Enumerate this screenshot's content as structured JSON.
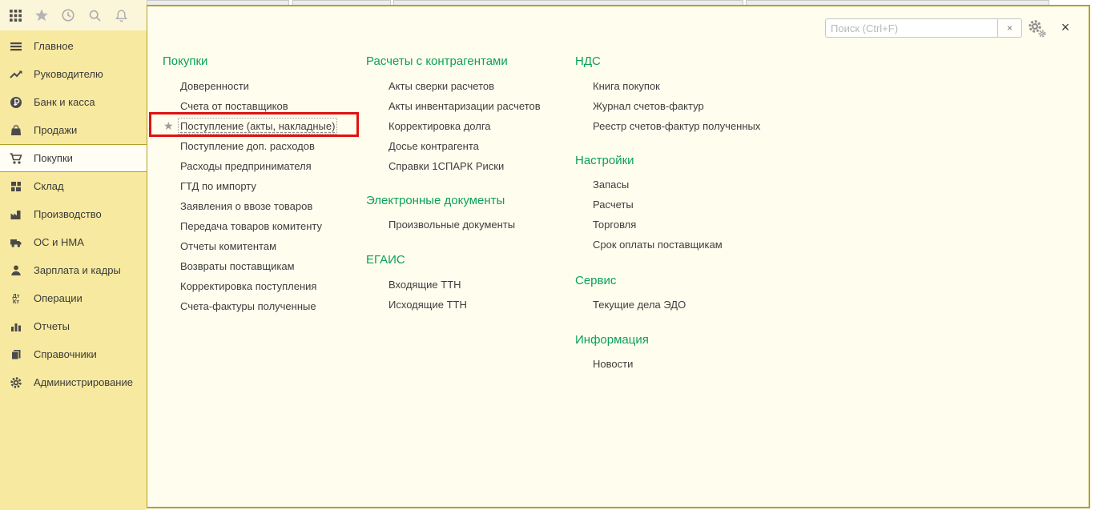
{
  "colors": {
    "sidebar_bg": "#f8e9a0",
    "toolbar_bg": "#fbf5d9",
    "panel_bg": "#fffdee",
    "olive_border": "#b3a128",
    "header_green": "#0aa158",
    "link_text": "#3e3e3e",
    "annotation_red": "#e01212"
  },
  "topbar": {
    "icons": [
      "apps-grid",
      "favorites-star",
      "history-clock",
      "search-magnifier",
      "notifications-bell"
    ]
  },
  "sidebar": {
    "items": [
      {
        "label": "Главное",
        "icon": "menu"
      },
      {
        "label": "Руководителю",
        "icon": "trend-arrow"
      },
      {
        "label": "Банк и касса",
        "icon": "ruble-coin"
      },
      {
        "label": "Продажи",
        "icon": "shopping-bag"
      },
      {
        "label": "Покупки",
        "icon": "shopping-cart",
        "selected": true
      },
      {
        "label": "Склад",
        "icon": "warehouse-grid"
      },
      {
        "label": "Производство",
        "icon": "factory"
      },
      {
        "label": "ОС и НМА",
        "icon": "truck"
      },
      {
        "label": "Зарплата и кадры",
        "icon": "person"
      },
      {
        "label": "Операции",
        "icon": "dt-kt",
        "icon_text_top": "Дт",
        "icon_text_bottom": "Кт"
      },
      {
        "label": "Отчеты",
        "icon": "bar-chart"
      },
      {
        "label": "Справочники",
        "icon": "books"
      },
      {
        "label": "Администрирование",
        "icon": "gear"
      }
    ]
  },
  "panel": {
    "search": {
      "placeholder": "Поиск (Ctrl+F)",
      "clear_label": "×"
    },
    "close_label": "×",
    "star_glyph": "★",
    "annotation": {
      "type": "red-box",
      "target": "Поступление (акты, накладные)"
    },
    "columns": [
      {
        "sections": [
          {
            "title": "Покупки",
            "items": [
              {
                "label": "Доверенности"
              },
              {
                "label": "Счета от поставщиков"
              },
              {
                "label": "Поступление (акты, накладные)",
                "starred": true,
                "highlighted": true
              },
              {
                "label": "Поступление доп. расходов"
              },
              {
                "label": "Расходы предпринимателя"
              },
              {
                "label": "ГТД по импорту"
              },
              {
                "label": "Заявления о ввозе товаров"
              },
              {
                "label": "Передача товаров комитенту"
              },
              {
                "label": "Отчеты комитентам"
              },
              {
                "label": "Возвраты поставщикам"
              },
              {
                "label": "Корректировка поступления"
              },
              {
                "label": "Счета-фактуры полученные"
              }
            ]
          }
        ]
      },
      {
        "sections": [
          {
            "title": "Расчеты с контрагентами",
            "items": [
              {
                "label": "Акты сверки расчетов"
              },
              {
                "label": "Акты инвентаризации расчетов"
              },
              {
                "label": "Корректировка долга"
              },
              {
                "label": "Досье контрагента"
              },
              {
                "label": "Справки 1СПАРК Риски"
              }
            ]
          },
          {
            "title": "Электронные документы",
            "items": [
              {
                "label": "Произвольные документы"
              }
            ]
          },
          {
            "title": "ЕГАИС",
            "items": [
              {
                "label": "Входящие ТТН"
              },
              {
                "label": "Исходящие ТТН"
              }
            ]
          }
        ]
      },
      {
        "sections": [
          {
            "title": "НДС",
            "items": [
              {
                "label": "Книга покупок"
              },
              {
                "label": "Журнал счетов-фактур"
              },
              {
                "label": "Реестр счетов-фактур полученных"
              }
            ]
          },
          {
            "title": "Настройки",
            "items": [
              {
                "label": "Запасы"
              },
              {
                "label": "Расчеты"
              },
              {
                "label": "Торговля"
              },
              {
                "label": "Срок оплаты поставщикам"
              }
            ]
          },
          {
            "title": "Сервис",
            "items": [
              {
                "label": "Текущие дела ЭДО"
              }
            ]
          },
          {
            "title": "Информация",
            "items": [
              {
                "label": "Новости"
              }
            ]
          }
        ]
      }
    ]
  }
}
